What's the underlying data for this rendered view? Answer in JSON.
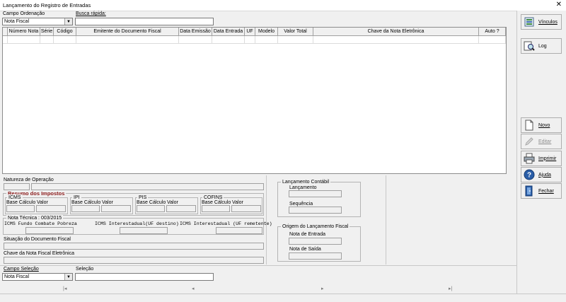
{
  "window": {
    "title": "Lançamento do Registro de Entradas",
    "close_glyph": "✕"
  },
  "top": {
    "campo_ordenacao_label": "Campo Ordenação",
    "campo_ordenacao_value": "Nota Fiscal",
    "busca_label": "Busca rápida:",
    "busca_value": ""
  },
  "grid": {
    "columns": [
      "",
      "Número Nota",
      "Série",
      "Código",
      "Emitente do Documento Fiscal",
      "Data Emissão",
      "Data Entrada",
      "UF",
      "Modelo",
      "Valor Total",
      "Chave da Nota Eletrônica",
      "Auto ?"
    ],
    "rows": [
      [
        "",
        "",
        "",
        "",
        "",
        "",
        "",
        "",
        "",
        "",
        "",
        ""
      ]
    ]
  },
  "side_buttons": [
    {
      "label": "Vínculos",
      "icon": "vinculos-icon",
      "enabled": true
    },
    {
      "label": "Log",
      "icon": "log-search-icon",
      "enabled": true
    },
    {
      "label": "Novo",
      "icon": "new-document-icon",
      "enabled": true
    },
    {
      "label": "Editar",
      "icon": "edit-icon",
      "enabled": false
    },
    {
      "label": "Imprimir",
      "icon": "printer-icon",
      "enabled": true
    },
    {
      "label": "Ajuda",
      "icon": "help-icon",
      "enabled": true
    },
    {
      "label": "Fechar",
      "icon": "exit-door-icon",
      "enabled": true
    }
  ],
  "details": {
    "natureza_label": "Natureza de Operação",
    "resumo_label": "Resumo dos Impostos",
    "icms_label": "ICMS",
    "ipi_label": "IPI",
    "pis_label": "PIS",
    "cofins_label": "COFINS",
    "base_calculo_label": "Base Cálculo",
    "valor_label": "Valor",
    "nota_tecnica_label": "Nota Técnica : 003/2015",
    "icms_fundo_label": "ICMS Fundo Combate Pobreza",
    "icms_destino_label": "ICMS Interestadual(UF destino)",
    "icms_remetente_label": "ICMS Interestadual (UF remetente)",
    "situacao_label": "Situação do Documento Fiscal",
    "chave_label": "Chave da Nota Fiscal Eletrônica"
  },
  "contabil": {
    "group_label": "Lançamento Contábil",
    "lancamento_label": "Lançamento",
    "sequencia_label": "Sequência"
  },
  "origem": {
    "group_label": "Origem do Lançamento Fiscal",
    "nota_entrada_label": "Nota de Entrada",
    "nota_saida_label": "Nota de Saída"
  },
  "bottom": {
    "campo_selecao_label": "Campo Seleção",
    "campo_selecao_value": "Nota Fiscal",
    "selecao_label": "Seleção",
    "selecao_value": ""
  },
  "navigator": {
    "first": "|◂",
    "prior": "◂",
    "next": "▸",
    "last": "▸|"
  }
}
